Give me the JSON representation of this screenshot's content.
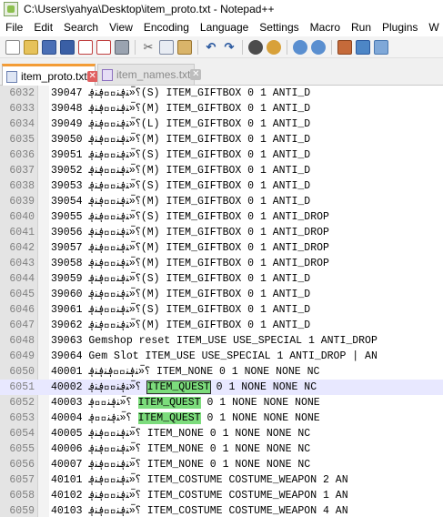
{
  "window": {
    "title": "C:\\Users\\yahya\\Desktop\\item_proto.txt - Notepad++"
  },
  "menu": [
    "File",
    "Edit",
    "Search",
    "View",
    "Encoding",
    "Language",
    "Settings",
    "Macro",
    "Run",
    "Plugins",
    "W"
  ],
  "toolbar": {
    "icons": [
      "new-file-icon",
      "open-file-icon",
      "save-icon",
      "save-all-icon",
      "close-icon",
      "close-all-icon",
      "print-icon",
      "cut-icon",
      "copy-icon",
      "paste-icon",
      "undo-icon",
      "redo-icon",
      "find-icon",
      "replace-icon",
      "zoom-in-icon",
      "zoom-out-icon",
      "sync-scroll-icon",
      "word-wrap-icon",
      "more-icon"
    ]
  },
  "tabs": [
    {
      "label": "item_proto.txt",
      "close": "✕",
      "active": true
    },
    {
      "label": "item_names.txt",
      "close": "✕",
      "active": false
    }
  ],
  "editor": {
    "current_line": 6051,
    "lines": [
      {
        "num": "6032",
        "text": "39047  ؟ࠡ«ﻨ؋ﻨ؋ؔ؋ﻨ؋(S)    ITEM_GIFTBOX     0    1    ANTI_D"
      },
      {
        "num": "6033",
        "text": "39048  ؟ࠡ«ﻨ؋ﻨ؋ؔ؋ﻨ؋(M)    ITEM_GIFTBOX     0    1    ANTI_D"
      },
      {
        "num": "6034",
        "text": "39049  ؟ࠡ«ﻨ؋ﻨ؋ؔ؋ﻨ؋(L)    ITEM_GIFTBOX     0    1    ANTI_D"
      },
      {
        "num": "6035",
        "text": "39050  ؟ࠡ«ﻨ؋ﻨ؋ؔ؋ﻨ؋(M)    ITEM_GIFTBOX     0    1    ANTI_D"
      },
      {
        "num": "6036",
        "text": "39051  ؟ࠡ«ﻨ؋ﻨ؋ؔ؋ﻨ؋(S)    ITEM_GIFTBOX     0    1    ANTI_D"
      },
      {
        "num": "6037",
        "text": "39052  ؟ࠡ«ﻨ؋ﻨ؋ؔ؋ﻨ؋(M)    ITEM_GIFTBOX     0    1    ANTI_D"
      },
      {
        "num": "6038",
        "text": "39053  ؟ࠡ«ﻨ؋ﻨ؋ؔ؋ﻨ؋(S)    ITEM_GIFTBOX     0    1    ANTI_D"
      },
      {
        "num": "6039",
        "text": "39054  ؟ࠡ«ﻨ؋ﻨ؋ؔ؋ﻨ؋(M)    ITEM_GIFTBOX     0    1    ANTI_D"
      },
      {
        "num": "6040",
        "text": "39055  ؟ࠡ«ﻨ؋ﻨ؋ؔ؋ﻨ؋(S)  ITEM_GIFTBOX    0    1   ANTI_DROP"
      },
      {
        "num": "6041",
        "text": "39056  ؟ࠡ«ﻨ؋ﻨ؋ؔ؋ﻨ؋(M)  ITEM_GIFTBOX    0    1   ANTI_DROP"
      },
      {
        "num": "6042",
        "text": "39057  ؟ࠡ«ﻨ؋ﻨ؋ؔ؋ﻨ؋(M)  ITEM_GIFTBOX    0    1   ANTI_DROP"
      },
      {
        "num": "6043",
        "text": "39058  ؟ࠡ«ﻨ؋ﻨ؋ؔ؋ﻨ؋(M)  ITEM_GIFTBOX    0    1   ANTI_DROP"
      },
      {
        "num": "6044",
        "text": "39059  ؟ࠡ«ﻨ؋ﻨ؋ؔ؋ﻨ؋(S)    ITEM_GIFTBOX     0    1    ANTI_D"
      },
      {
        "num": "6045",
        "text": "39060  ؟ࠡ«ﻨ؋ﻨ؋ؔ؋ﻨ؋(M)    ITEM_GIFTBOX     0    1    ANTI_D"
      },
      {
        "num": "6046",
        "text": "39061  ؟ࠡ«ﻨ؋ﻨ؋ؔ؋ﻨ؋(S)    ITEM_GIFTBOX     0    1    ANTI_D"
      },
      {
        "num": "6047",
        "text": "39062  ؟ࠡ«ﻨ؋ﻨ؋ؔ؋ﻨ؋(M)    ITEM_GIFTBOX     0    1    ANTI_D"
      },
      {
        "num": "6048",
        "text": "39063  Gemshop reset    ITEM_USE    USE_SPECIAL 1    ANTI_DROP"
      },
      {
        "num": "6049",
        "text": "39064  Gem Slot    ITEM_USE    USE_SPECIAL 1    ANTI_DROP | AN"
      },
      {
        "num": "6050",
        "text": "40001  ؟ࠡ«ﻨ؋ﻨ؋ؔ؋ﻨ؋ﻨ؋    ITEM_NONE    0    1    NONE     NONE     NC"
      },
      {
        "num": "6051",
        "text": "40002  ؟ࠡ«ﻨ؋ﻨ؋ؔ؋ﻨ؋    ",
        "hl": "ITEM_QUEST",
        "after": "  0    1    NONE     NONE     NC"
      },
      {
        "num": "6052",
        "text": "40003  ؟ࠡ«ﻨ؋ﻨ؋ؔ؋ ",
        "hl": "ITEM_QUEST",
        "after": "  0    1    NONE     NONE     NONE"
      },
      {
        "num": "6053",
        "text": "40004  ؟ࠡ«ﻨ؋ﻨ؋ؔ؋ ",
        "hl": "ITEM_QUEST",
        "after": "  0    1    NONE     NONE     NONE"
      },
      {
        "num": "6054",
        "text": "40005  ؟ࠡ«ﻨ؋ﻨ؋ؔ؋ﻨ؋    ITEM_NONE    0    1    NONE     NONE     NC"
      },
      {
        "num": "6055",
        "text": "40006  ؟ࠡ«ﻨ؋ﻨ؋ؔ؋ﻨ؋    ITEM_NONE    0    1    NONE     NONE     NC"
      },
      {
        "num": "6056",
        "text": "40007  ؟ࠡ«ﻨ؋ﻨ؋ؔ؋ﻨ؋    ITEM_NONE    0    1    NONE     NONE     NC"
      },
      {
        "num": "6057",
        "text": "40101  ؟ࠡ«ﻨ؋ﻨ؋ؔ؋ﻨ؋    ITEM_COSTUME    COSTUME_WEAPON  2    AN"
      },
      {
        "num": "6058",
        "text": "40102  ؟ࠡ«ﻨ؋ﻨ؋ؔ؋ﻨ؋    ITEM_COSTUME    COSTUME_WEAPON  1    AN"
      },
      {
        "num": "6059",
        "text": "40103  ؟ࠡ«ﻨ؋ﻨ؋ؔ؋ﻨ؋    ITEM_COSTUME    COSTUME_WEAPON  4    AN"
      }
    ]
  }
}
